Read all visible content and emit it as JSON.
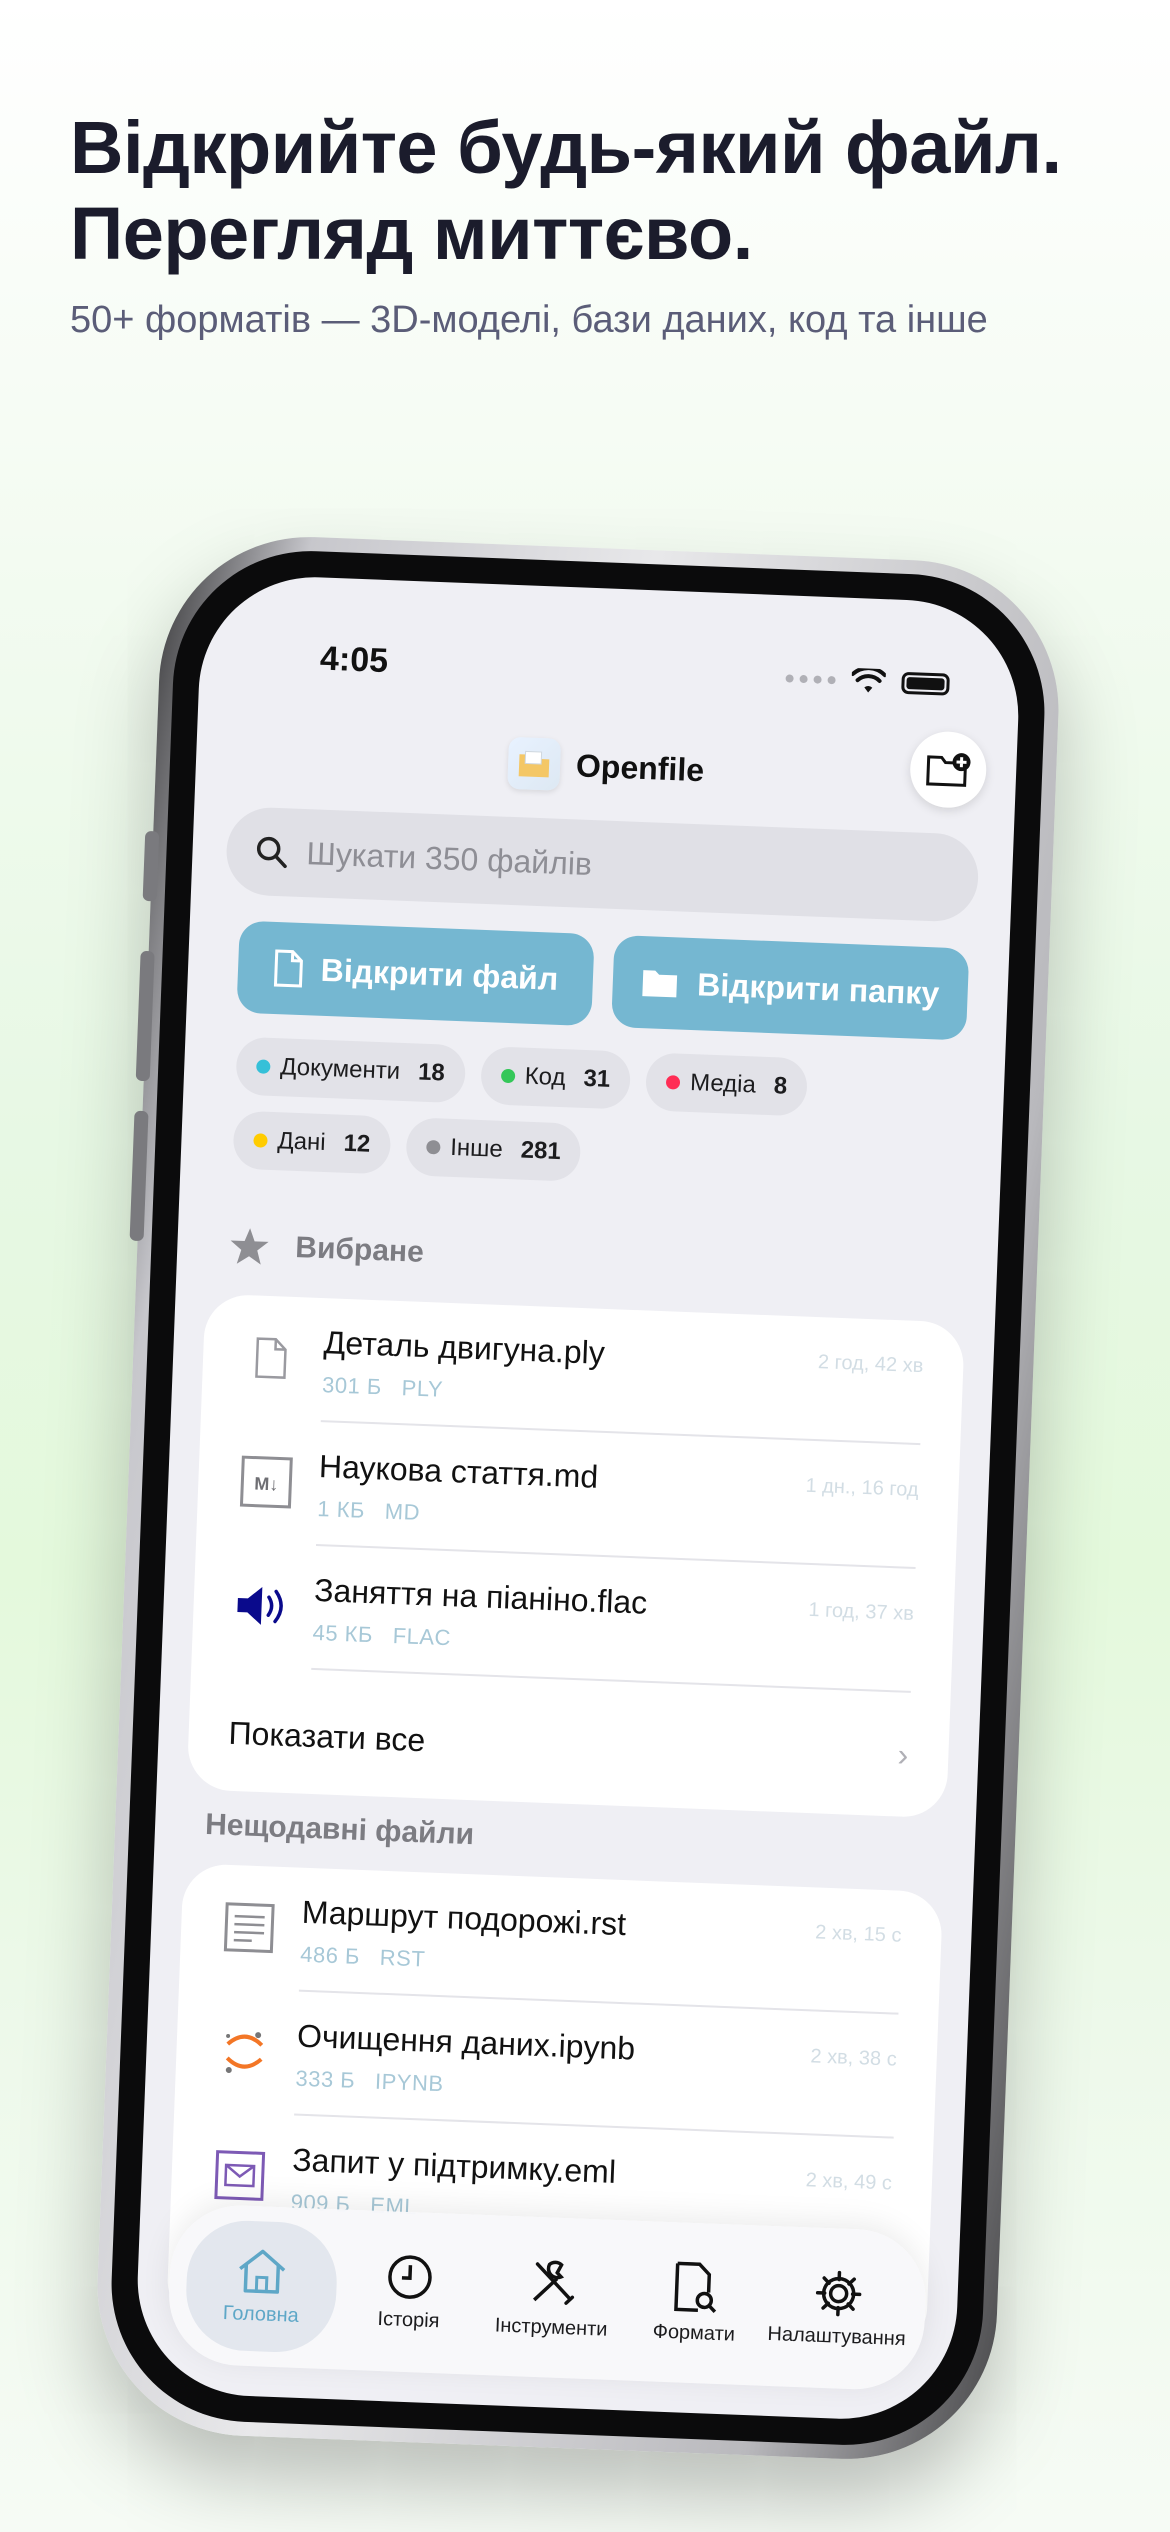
{
  "hero": {
    "title_line1": "Відкрийте будь-який файл.",
    "title_line2": "Перегляд миттєво.",
    "subtitle": "50+ форматів — 3D-моделі, бази даних, код та інше"
  },
  "status": {
    "time": "4:05"
  },
  "app": {
    "name": "Openfile"
  },
  "search": {
    "placeholder": "Шукати 350 файлів"
  },
  "actions": {
    "open_file": "Відкрити файл",
    "open_folder": "Відкрити папку"
  },
  "chips": [
    {
      "label": "Документи",
      "count": "18",
      "color": "#35c0d8"
    },
    {
      "label": "Код",
      "count": "31",
      "color": "#34c759"
    },
    {
      "label": "Медіа",
      "count": "8",
      "color": "#ff2d55"
    },
    {
      "label": "Дані",
      "count": "12",
      "color": "#ffcc00"
    },
    {
      "label": "Інше",
      "count": "281",
      "color": "#8e8e93"
    }
  ],
  "favorites": {
    "title": "Вибране",
    "items": [
      {
        "name": "Деталь двигуна.ply",
        "size": "301 Б",
        "ext": "PLY",
        "time": "2 год, 42 хв",
        "icon": "document-icon"
      },
      {
        "name": "Наукова стаття.md",
        "size": "1 КБ",
        "ext": "MD",
        "time": "1 дн., 16 год",
        "icon": "markdown-icon"
      },
      {
        "name": "Заняття на піаніно.flac",
        "size": "45 КБ",
        "ext": "FLAC",
        "time": "1 год, 37 хв",
        "icon": "speaker-icon"
      }
    ],
    "show_all": "Показати все"
  },
  "recent": {
    "title": "Нещодавні файли",
    "items": [
      {
        "name": "Маршрут подорожі.rst",
        "size": "486 Б",
        "ext": "RST",
        "time": "2 хв, 15 с",
        "icon": "text-doc-icon"
      },
      {
        "name": "Очищення даних.ipynb",
        "size": "333 Б",
        "ext": "IPYNB",
        "time": "2 хв, 38 с",
        "icon": "jupyter-icon"
      },
      {
        "name": "Запит у підтримку.eml",
        "size": "909 Б",
        "ext": "EML",
        "time": "2 хв, 49 с",
        "icon": "mail-icon"
      }
    ]
  },
  "tabs": [
    {
      "label": "Головна",
      "icon": "home-icon"
    },
    {
      "label": "Історія",
      "icon": "clock-icon"
    },
    {
      "label": "Інструменти",
      "icon": "tools-icon"
    },
    {
      "label": "Формати",
      "icon": "formats-icon"
    },
    {
      "label": "Налаштування",
      "icon": "gear-icon"
    }
  ],
  "colors": {
    "accent": "#75b7d1",
    "tab_active": "#5ea7c7",
    "title": "#1b1c2c"
  }
}
